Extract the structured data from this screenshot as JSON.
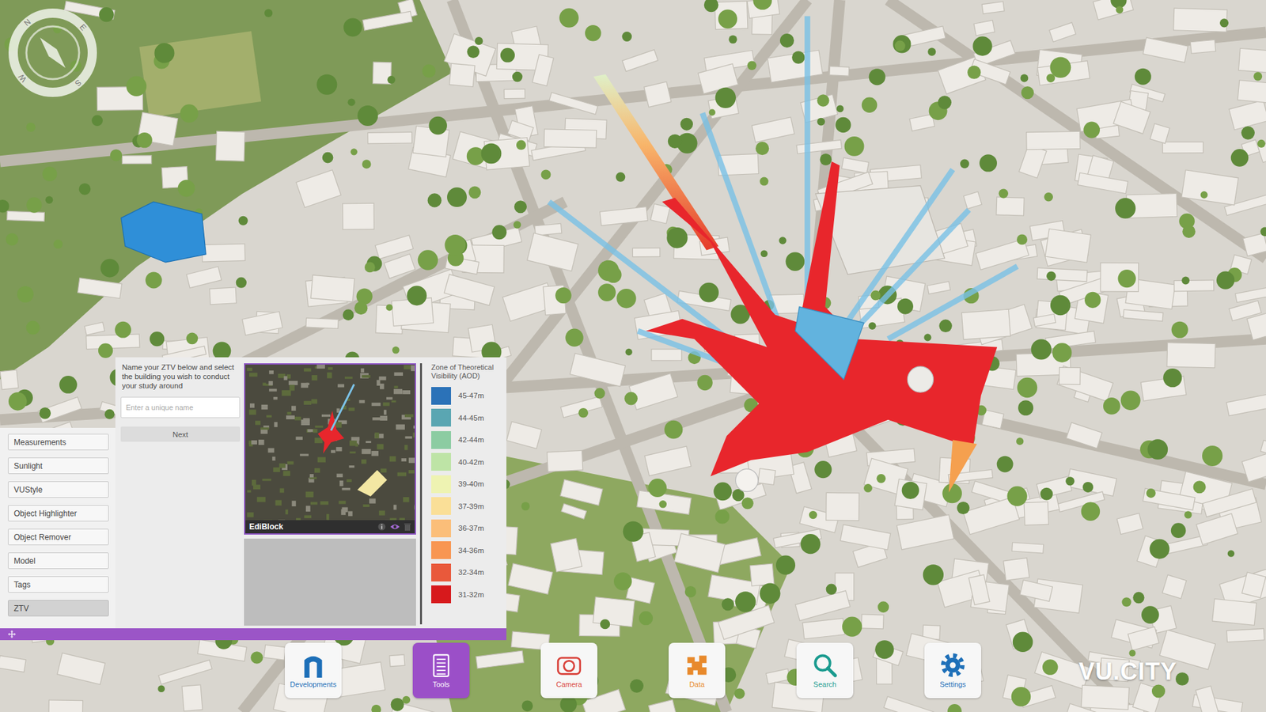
{
  "compass": {
    "letters": [
      "N",
      "E",
      "S",
      "W"
    ]
  },
  "tool_menu": {
    "items": [
      {
        "label": "Measurements",
        "selected": false
      },
      {
        "label": "Sunlight",
        "selected": false
      },
      {
        "label": "VUStyle",
        "selected": false
      },
      {
        "label": "Object Highlighter",
        "selected": false
      },
      {
        "label": "Object Remover",
        "selected": false
      },
      {
        "label": "Model",
        "selected": false
      },
      {
        "label": "Tags",
        "selected": false
      },
      {
        "label": "ZTV",
        "selected": true
      }
    ]
  },
  "ztv_panel": {
    "instruction": "Name your ZTV below and select the building you wish to conduct your study around",
    "name_field": {
      "placeholder": "Enter a unique name"
    },
    "next_button": "Next"
  },
  "saved_studies": [
    {
      "name": "EdiBlock"
    }
  ],
  "legend": {
    "title": "Zone of Theoretical Visibility (AOD)",
    "items": [
      {
        "label": "45-47m",
        "color": "#2b72b8"
      },
      {
        "label": "44-45m",
        "color": "#5aa6b2"
      },
      {
        "label": "42-44m",
        "color": "#8ccca2"
      },
      {
        "label": "40-42m",
        "color": "#bee4a6"
      },
      {
        "label": "39-40m",
        "color": "#eef3b2"
      },
      {
        "label": "37-39m",
        "color": "#fadf97"
      },
      {
        "label": "36-37m",
        "color": "#fbbe79"
      },
      {
        "label": "34-36m",
        "color": "#f89652"
      },
      {
        "label": "32-34m",
        "color": "#e9593b"
      },
      {
        "label": "31-32m",
        "color": "#d7191c"
      }
    ]
  },
  "toolbar": {
    "items": [
      {
        "label": "Developments",
        "selected": false,
        "color": "#1d6fb8"
      },
      {
        "label": "Tools",
        "selected": true,
        "color": "#ffffff"
      },
      {
        "label": "Camera",
        "selected": false,
        "color": "#d9423b"
      },
      {
        "label": "Data",
        "selected": false,
        "color": "#e8892b"
      },
      {
        "label": "Search",
        "selected": false,
        "color": "#1a9b8f"
      },
      {
        "label": "Settings",
        "selected": false,
        "color": "#1d6fb8"
      }
    ]
  },
  "logo": "VU.CITY"
}
